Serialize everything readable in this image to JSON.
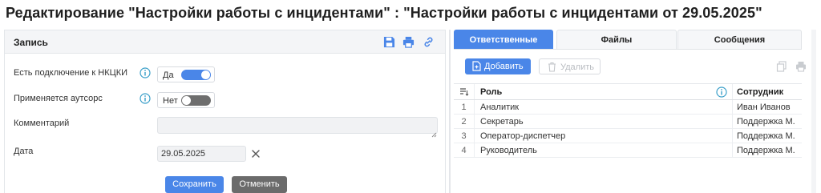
{
  "page": {
    "title": "Редактирование \"Настройки работы с инцидентами\" : \"Настройки работы с инцидентами от 29.05.2025\""
  },
  "record": {
    "header": "Запись",
    "header_icons": [
      "save-icon",
      "print-icon",
      "link-icon"
    ],
    "fields": {
      "nkcki": {
        "label": "Есть подключение к НКЦКИ",
        "value": "Да",
        "enabled": true
      },
      "outsourcing": {
        "label": "Применяется аутсорс",
        "value": "Нет",
        "enabled": false
      },
      "comment": {
        "label": "Комментарий",
        "value": ""
      },
      "date": {
        "label": "Дата",
        "value": "29.05.2025"
      }
    },
    "buttons": {
      "save": "Сохранить",
      "cancel": "Отменить"
    }
  },
  "tabs": [
    {
      "label": "Ответственные",
      "active": true
    },
    {
      "label": "Файлы",
      "active": false
    },
    {
      "label": "Сообщения",
      "active": false
    }
  ],
  "toolbar": {
    "add_label": "Добавить",
    "delete_label": "Удалить",
    "right_icons": [
      "copy-icon",
      "print-icon"
    ]
  },
  "grid": {
    "columns": {
      "role": "Роль",
      "employee": "Сотрудник"
    },
    "rows": [
      {
        "num": "1",
        "role": "Аналитик",
        "employee": "Иван Иванов"
      },
      {
        "num": "2",
        "role": "Секретарь",
        "employee": "Поддержка М."
      },
      {
        "num": "3",
        "role": "Оператор-диспетчер",
        "employee": "Поддержка М."
      },
      {
        "num": "4",
        "role": "Руководитель",
        "employee": "Поддержка М."
      }
    ]
  },
  "colors": {
    "accent": "#4a86e8",
    "secondary_button": "#6b6b6b",
    "info_icon": "#3a9fc9"
  }
}
